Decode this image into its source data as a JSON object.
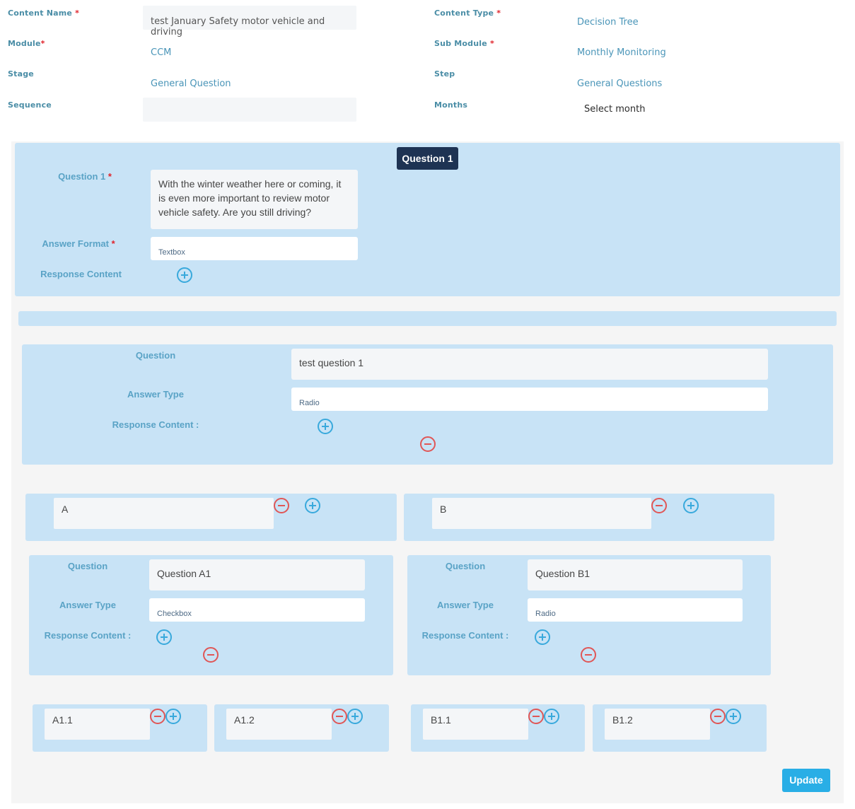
{
  "header_form": {
    "content_name": {
      "label": "Content Name",
      "required": "*",
      "value": "test January Safety motor vehicle and driving"
    },
    "content_type": {
      "label": "Content Type",
      "required": "*",
      "value": "Decision Tree"
    },
    "module": {
      "label": "Module",
      "required": "*",
      "value": "CCM"
    },
    "sub_module": {
      "label": "Sub Module",
      "required": "*",
      "value": "Monthly Monitoring"
    },
    "stage": {
      "label": "Stage",
      "value": "General Question"
    },
    "step": {
      "label": "Step",
      "value": "General Questions"
    },
    "sequence": {
      "label": "Sequence",
      "value": ""
    },
    "months": {
      "label": "Months",
      "value": "Select month"
    }
  },
  "question_block": {
    "badge": "Question 1",
    "question_label": "Question 1",
    "required": "*",
    "question_text": "With the winter weather here or coming, it is even more important to review motor vehicle safety. Are you still driving?",
    "answer_format_label": "Answer Format",
    "answer_format_value": "Textbox",
    "response_content_label": "Response Content"
  },
  "tree": {
    "root": {
      "question_label": "Question",
      "question_value": "test question 1",
      "answer_type_label": "Answer Type",
      "answer_type_value": "Radio",
      "response_label": "Response Content :"
    },
    "answers": [
      {
        "value": "A",
        "sub": {
          "question_label": "Question",
          "question_value": "Question A1",
          "answer_type_label": "Answer Type",
          "answer_type_value": "Checkbox",
          "response_label": "Response Content :",
          "options": [
            "A1.1",
            "A1.2"
          ]
        }
      },
      {
        "value": "B",
        "sub": {
          "question_label": "Question",
          "question_value": "Question B1",
          "answer_type_label": "Answer Type",
          "answer_type_value": "Radio",
          "response_label": "Response Content :",
          "options": [
            "B1.1",
            "B1.2"
          ]
        }
      }
    ]
  },
  "actions": {
    "update_label": "Update"
  },
  "colors": {
    "panel": "#c8e3f6",
    "badge": "#1e3353",
    "update": "#29aee6",
    "add": "#39a9dc",
    "remove": "#e05656",
    "required": "#e0242c"
  }
}
